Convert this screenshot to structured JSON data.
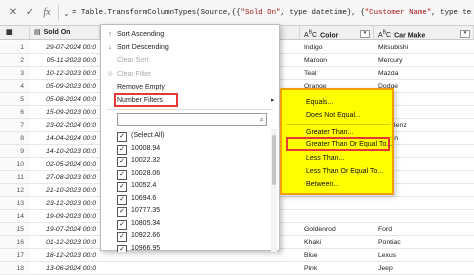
{
  "formula_bar": {
    "cancel_icon": "✕",
    "confirm_icon": "✓",
    "fx_label": "fx",
    "formula_prefix": "= Table.TransformColumnTypes(Source,{{",
    "formula_s1": "\"Sold On\"",
    "formula_mid1": ", type datetime}, {",
    "formula_s2": "\"Customer Name\"",
    "formula_mid2": ", type text},"
  },
  "headers": {
    "sold_on": "Sold On",
    "color": "Color",
    "car_make": "Car Make"
  },
  "rows": [
    {
      "n": "1",
      "sold": "29-07-2024 00:0",
      "color": "Indigo",
      "make": "Mitsubishi"
    },
    {
      "n": "2",
      "sold": "05-11-2023 00:0",
      "color": "Maroon",
      "make": "Mercury"
    },
    {
      "n": "3",
      "sold": "10-12-2023 00:0",
      "color": "Teal",
      "make": "Mazda"
    },
    {
      "n": "4",
      "sold": "05-09-2023 00:0",
      "color": "Orange",
      "make": "Dodge"
    },
    {
      "n": "5",
      "sold": "05-08-2024 00:0",
      "color": "",
      "make": ""
    },
    {
      "n": "6",
      "sold": "15-09-2023 00:0",
      "color": "",
      "make": "olet"
    },
    {
      "n": "7",
      "sold": "23-02-2024 00:0",
      "color": "",
      "make": "des-Benz"
    },
    {
      "n": "8",
      "sold": "14-04-2024 00:0",
      "color": "",
      "make": "wagen"
    },
    {
      "n": "9",
      "sold": "14-10-2023 00:0",
      "color": "",
      "make": ""
    },
    {
      "n": "10",
      "sold": "02-05-2024 00:0",
      "color": "",
      "make": ""
    },
    {
      "n": "11",
      "sold": "27-08-2023 00:0",
      "color": "",
      "make": ""
    },
    {
      "n": "12",
      "sold": "21-10-2023 00:0",
      "color": "",
      "make": ""
    },
    {
      "n": "13",
      "sold": "23-12-2023 00:0",
      "color": "",
      "make": ""
    },
    {
      "n": "14",
      "sold": "19-09-2023 00:0",
      "color": "",
      "make": ""
    },
    {
      "n": "15",
      "sold": "19-07-2024 00:0",
      "color": "Goldenrod",
      "make": "Ford"
    },
    {
      "n": "16",
      "sold": "01-12-2023 00:0",
      "color": "Khaki",
      "make": "Pontiac"
    },
    {
      "n": "17",
      "sold": "18-12-2023 00:0",
      "color": "Blue",
      "make": "Lexus"
    },
    {
      "n": "18",
      "sold": "13-06-2024 00:0",
      "color": "Pink",
      "make": "Jeep"
    }
  ],
  "menu": {
    "sort_asc": "Sort Ascending",
    "sort_desc": "Sort Descending",
    "clear_sort": "Clear Sort",
    "clear_filter": "Clear Filter",
    "remove_empty": "Remove Empty",
    "number_filters": "Number Filters",
    "search_placeholder": "",
    "items": [
      "(Select All)",
      "10008.94",
      "10022.32",
      "10028.06",
      "10052.4",
      "10694.6",
      "10777.35",
      "10805.34",
      "10922.66",
      "10966.95"
    ]
  },
  "submenu": {
    "equals": "Equals...",
    "not_equal": "Does Not Equal...",
    "greater_than": "Greater Than...",
    "greater_equal": "Greater Than Or Equal To...",
    "less_than": "Less Than...",
    "less_equal": "Less Than Or Equal To...",
    "between": "Between..."
  },
  "colors": {
    "highlight_yellow": "#ffff00",
    "highlight_red": "#e53935",
    "string_red": "#a31515"
  }
}
